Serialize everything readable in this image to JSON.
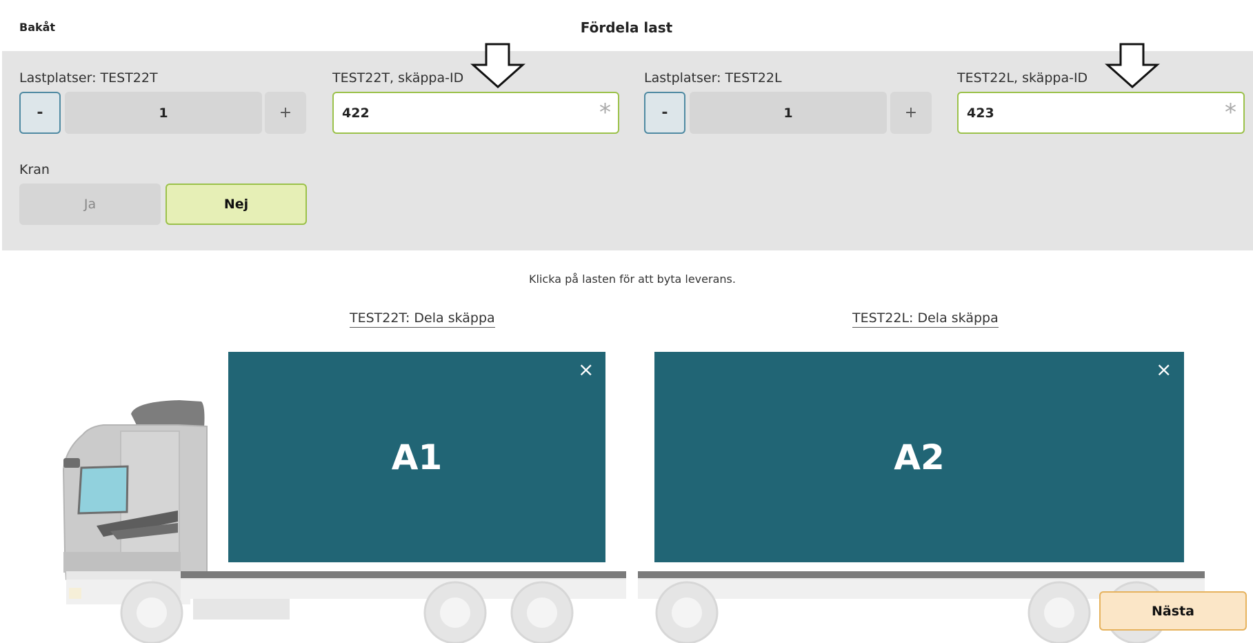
{
  "header": {
    "back_label": "Bakåt",
    "title": "Fördela last"
  },
  "slot1": {
    "label": "Lastplatser: TEST22T",
    "minus": "-",
    "value": "1",
    "plus": "+",
    "id_label": "TEST22T, skäppa-ID",
    "id_value": "422",
    "required_mark": "*"
  },
  "slot2": {
    "label": "Lastplatser: TEST22L",
    "minus": "-",
    "value": "1",
    "plus": "+",
    "id_label": "TEST22L, skäppa-ID",
    "id_value": "423",
    "required_mark": "*"
  },
  "crane": {
    "label": "Kran",
    "yes": "Ja",
    "no": "Nej",
    "selected": "Nej"
  },
  "hint": "Klicka på lasten för att byta leverans.",
  "vehicles": [
    {
      "link": "TEST22T: Dela skäppa",
      "cargo": "A1",
      "close": "×"
    },
    {
      "link": "TEST22L: Dela skäppa",
      "cargo": "A2",
      "close": "×"
    }
  ],
  "next_label": "Nästa",
  "colors": {
    "cargo": "#216575",
    "accent_green": "#9bc14a",
    "next_bg": "#fbe6c7"
  }
}
